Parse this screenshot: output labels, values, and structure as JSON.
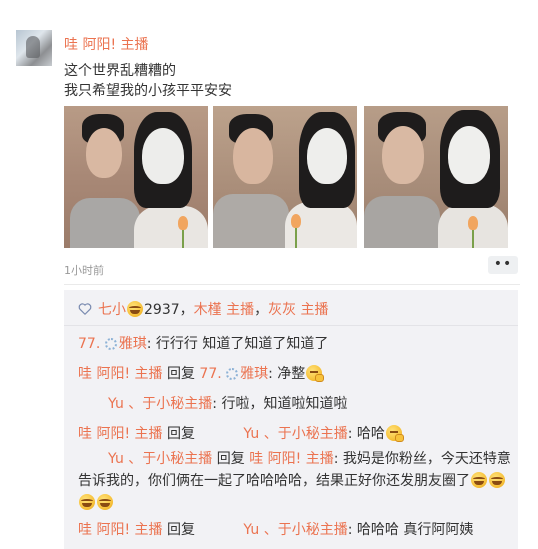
{
  "post": {
    "author": "哇 阿阳! 主播",
    "lines": [
      "这个世界乱糟糟的",
      "我只希望我的小孩平平安安"
    ],
    "timestamp": "1小时前",
    "more": "••"
  },
  "likes": {
    "user1": "七小",
    "count": "2937",
    "comma1": "，",
    "user2": "木槿 主播",
    "comma2": "，",
    "user3": "灰灰 主播"
  },
  "comments": [
    {
      "u1": "77.",
      "u2": "雅琪",
      "text": ": 行行行 知道了知道了知道了"
    },
    {
      "u1": "哇 阿阳! 主播",
      "reply": " 回复 ",
      "u2": "77.",
      "u3": "雅琪",
      "text": ": 净整"
    },
    {
      "u1": "Yu 、于小秘主播",
      "text": ": 行啦，知道啦知道啦"
    },
    {
      "u1": "哇 阿阳! 主播",
      "reply": " 回复 ",
      "u2": "Yu 、于小秘主播",
      "text": ": 哈哈"
    },
    {
      "u1": "Yu 、于小秘主播",
      "reply": " 回复 ",
      "u2": "哇 阿阳! 主播",
      "text": ": 我妈是你粉丝，今天还特意告诉我的，你们俩在一起了哈哈哈哈，结果正好你还发朋友圈了"
    },
    {
      "u1": "哇 阿阳! 主播",
      "reply": " 回复 ",
      "u2": "Yu 、于小秘主播",
      "text": ": 哈哈哈 真行阿阿姨"
    }
  ],
  "icons": {
    "heart": "heart-icon",
    "gear": "gear-icon",
    "laugh": "laugh-emoji",
    "think": "thinking-emoji"
  },
  "colors": {
    "name_link": "#eb7350",
    "background": "#ffffff",
    "comment_bg": "#f2f2f5"
  }
}
